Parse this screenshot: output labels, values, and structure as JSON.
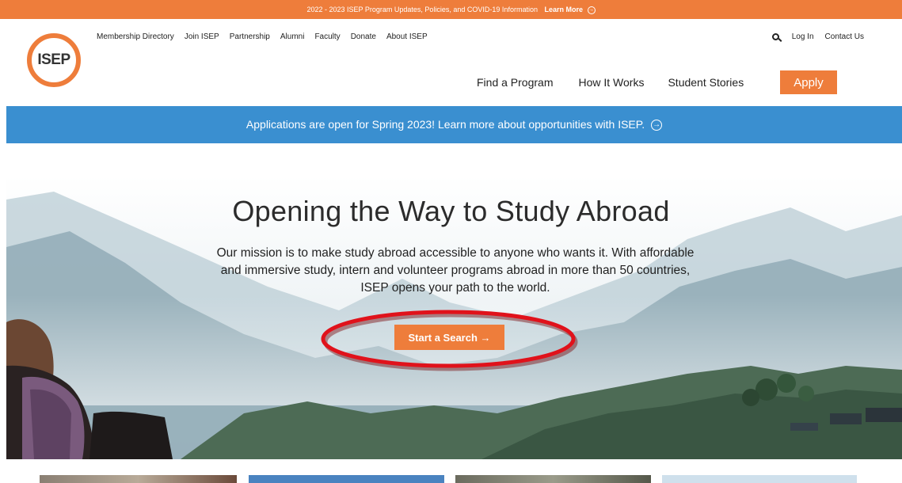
{
  "topbar": {
    "text": "2022 - 2023 ISEP Program Updates, Policies, and COVID-19 Information",
    "learn_more": "Learn More",
    "arrow": "→"
  },
  "logo": {
    "text": "ISEP"
  },
  "util_nav": [
    "Membership Directory",
    "Join ISEP",
    "Partnership",
    "Alumni",
    "Faculty",
    "Donate",
    "About ISEP"
  ],
  "right_util": {
    "login": "Log In",
    "contact": "Contact Us"
  },
  "main_nav": [
    "Find a Program",
    "How It Works",
    "Student Stories"
  ],
  "apply": "Apply",
  "banner": {
    "text": "Applications are open for Spring 2023! Learn more about opportunities with ISEP.",
    "arrow": "→"
  },
  "hero": {
    "title": "Opening the Way to Study Abroad",
    "desc1": "Our mission is to make study abroad accessible to anyone who wants it. With affordable",
    "desc2": "and immersive study, intern and volunteer programs abroad in more than 50 countries,",
    "desc3": "ISEP opens your path to the world.",
    "cta": "Start a Search →"
  },
  "colors": {
    "accent": "#ee7d3b",
    "banner": "#3a8fd0",
    "annotation": "#e0121b"
  }
}
